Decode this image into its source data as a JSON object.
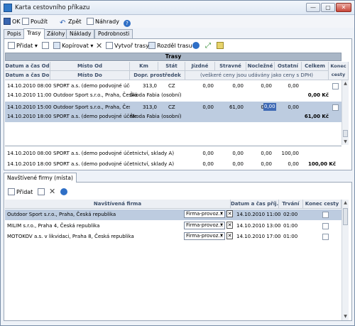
{
  "window": {
    "title": "Karta cestovního příkazu",
    "minimize": "—",
    "maximize": "▢",
    "close": "✕"
  },
  "toolbar": {
    "ok_label": "OK",
    "apply_label": "Použít",
    "back_label": "Zpět",
    "replace_label": "Náhrady",
    "help_label": "?"
  },
  "tabs": [
    "Popis",
    "Trasy",
    "Zálohy",
    "Náklady",
    "Podrobnosti"
  ],
  "trips_toolbar": {
    "add_label": "Přidat",
    "copy_label": "Kopírovat",
    "create_trips_label": "Vytvoř trasy",
    "split_trip_label": "Rozděl trasu"
  },
  "trips_grid": {
    "band_title": "Trasy",
    "headers_row1": [
      "Datum a čas Od",
      "Místo Od",
      "Km",
      "Stát",
      "Jízdné",
      "Stravné",
      "Nocležné",
      "Ostatní",
      "Celkem",
      "Konec cesty"
    ],
    "headers_row2": [
      "Datum a čas Do",
      "Místo Do",
      "Dopr. prostředek",
      "(veškeré ceny jsou udávány jako ceny s DPH)"
    ],
    "rows": [
      {
        "od": "14.10.2010  08:00",
        "mista_od": "SPORT a.s. (demo podvojné účetr",
        "km": "313,0",
        "stat": "CZ",
        "jizdne": "0,00",
        "stravne": "0,00",
        "nocl": "0,00",
        "ostatni": "0,00",
        "celkem": "",
        "do": "14.10.2010  11:00",
        "mista_do": "Outdoor Sport s.r.o., Praha, Česká",
        "dopr": "Škoda Fabia (osobní)",
        "jizdne2": "",
        "stravne2": "",
        "nocl2": "",
        "ostatni2": "",
        "celkem2": "0,00 Kč"
      },
      {
        "od": "14.10.2010  15:00",
        "mista_od": "Outdoor Sport s.r.o., Praha, Česká",
        "km": "313,0",
        "stat": "CZ",
        "jizdne": "0,00",
        "stravne": "61,00",
        "nocl": "0,00",
        "ostatni": "0,00",
        "celkem": "",
        "do": "14.10.2010  18:00",
        "mista_do": "SPORT a.s. (demo podvojné účetr",
        "dopr": "Škoda Fabia (osobní)",
        "jizdne2": "",
        "stravne2": "",
        "nocl2": "",
        "ostatni2": "",
        "celkem2": "61,00 Kč"
      }
    ],
    "summary": [
      {
        "datum": "14.10.2010  08:00",
        "text": "SPORT a.s. (demo podvojné účetnictví, sklady A)",
        "jizdne": "0,00",
        "stravne": "0,00",
        "nocl": "0,00",
        "ostatni": "100,00",
        "celkem": ""
      },
      {
        "datum": "14.10.2010  18:00",
        "text": "SPORT a.s. (demo podvojné účetnictví, sklady A)",
        "jizdne": "0,00",
        "stravne": "0,00",
        "nocl": "0,00",
        "ostatni": "0,00",
        "celkem": "100,00 Kč"
      }
    ]
  },
  "visited_section": {
    "tab_label": "Navštívené firmy (místa)",
    "add_label": "Přidat",
    "headers": [
      "Navštívená firma",
      "Datum a čas příj.",
      "Trvání",
      "Konec cesty"
    ],
    "rows": [
      {
        "firma": "Outdoor Sport s.r.o., Praha, Česká republika",
        "typ": "Firma-provoz...",
        "datum": "14.10.2010  11:00",
        "trvani": "02:00"
      },
      {
        "firma": "MILIM s.r.o., Praha 4, Česká republika",
        "typ": "Firma-provoz...",
        "datum": "14.10.2010  13:00",
        "trvani": "01:00"
      },
      {
        "firma": "MOTOKOV a.s. v likvidaci, Praha 8, Česká republika",
        "typ": "Firma-provoz...",
        "datum": "14.10.2010  17:00",
        "trvani": "01:00"
      }
    ]
  },
  "colors": {
    "selection": "#bdcce0",
    "edit_cell": "#3f6ab5",
    "band": "#a9b6c6"
  }
}
